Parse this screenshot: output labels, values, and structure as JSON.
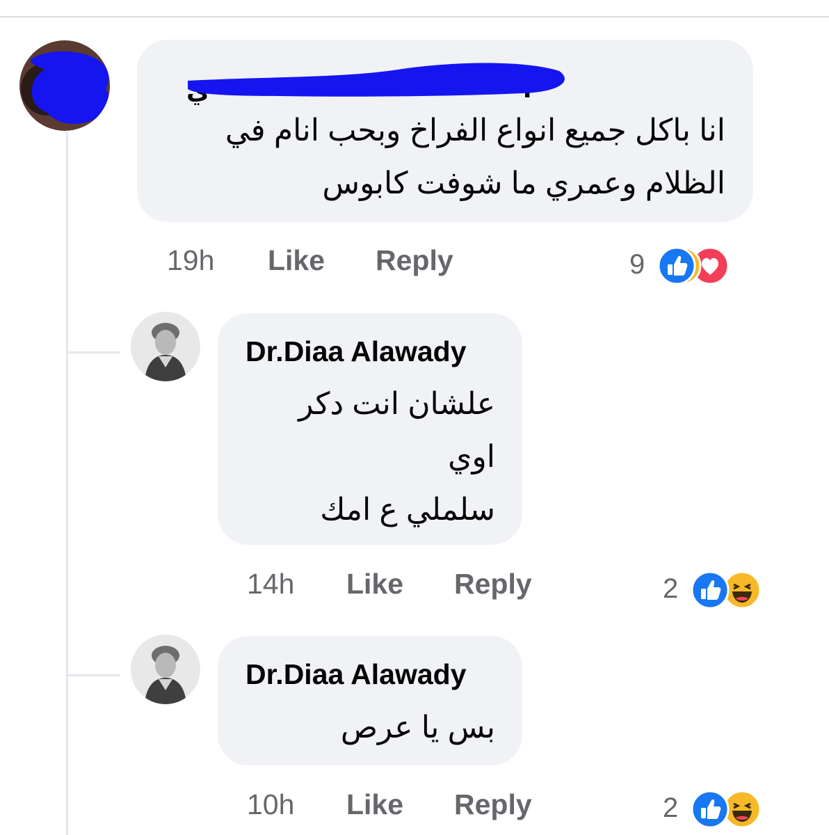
{
  "comments": [
    {
      "author": "",
      "text_lines": [
        "انا باكل  جميع انواع  الفراخ وبحب انام في",
        "الظلام  وعمري ما شوفت كابوس"
      ],
      "time": "19h",
      "like_label": "Like",
      "reply_label": "Reply",
      "reaction_count": "9",
      "reactions": [
        "like-icon",
        "haha-icon",
        "love-icon"
      ]
    },
    {
      "author": "Dr.Diaa Alawady",
      "text_lines": [
        "علشان انت دكر",
        "اوي",
        "سلملي ع امك"
      ],
      "time": "14h",
      "like_label": "Like",
      "reply_label": "Reply",
      "reaction_count": "2",
      "reactions": [
        "like-icon",
        "haha-icon"
      ]
    },
    {
      "author": "Dr.Diaa Alawady",
      "text_lines": [
        "بس يا عرص"
      ],
      "time": "10h",
      "like_label": "Like",
      "reply_label": "Reply",
      "reaction_count": "2",
      "reactions": [
        "like-icon",
        "haha-icon"
      ]
    }
  ],
  "colors": {
    "bubble": "#f0f2f5",
    "meta_text": "#65676b",
    "like_blue": "#1877f2",
    "haha_yellow": "#f7b928",
    "love_red": "#f33e58",
    "redaction_blue": "#1515f0"
  }
}
